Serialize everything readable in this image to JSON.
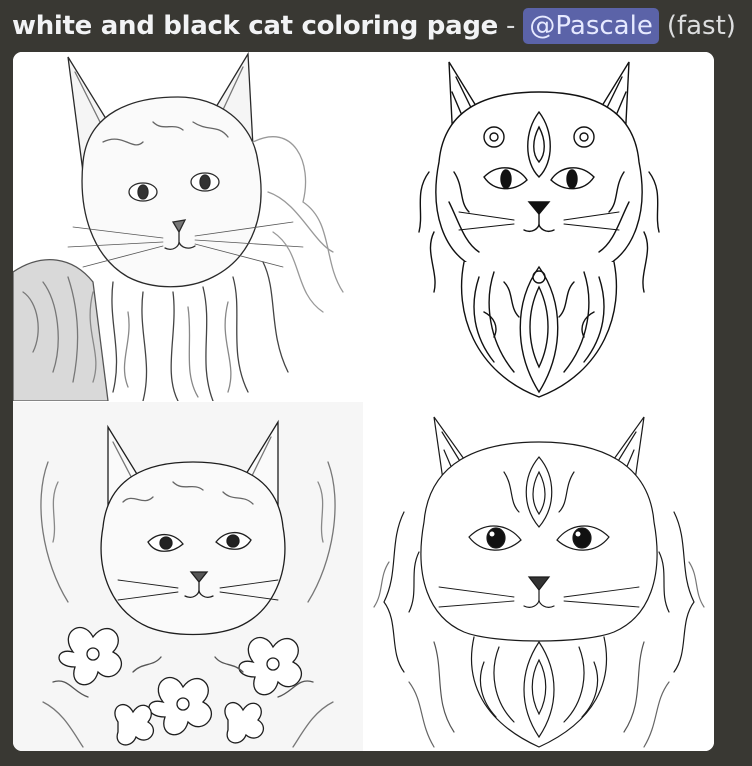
{
  "message": {
    "prompt": "white and black cat coloring page",
    "separator": "-",
    "mention": "@Pascale",
    "speed": "(fast)"
  },
  "images": [
    {
      "icon": "cat-sketch-image"
    },
    {
      "icon": "cat-mandala-image"
    },
    {
      "icon": "cat-floral-wreath-image"
    },
    {
      "icon": "cat-ornate-fur-image"
    }
  ],
  "colors": {
    "background": "#393833",
    "mention_bg": "#5b63a8",
    "line_art": "#1a1a1a"
  }
}
